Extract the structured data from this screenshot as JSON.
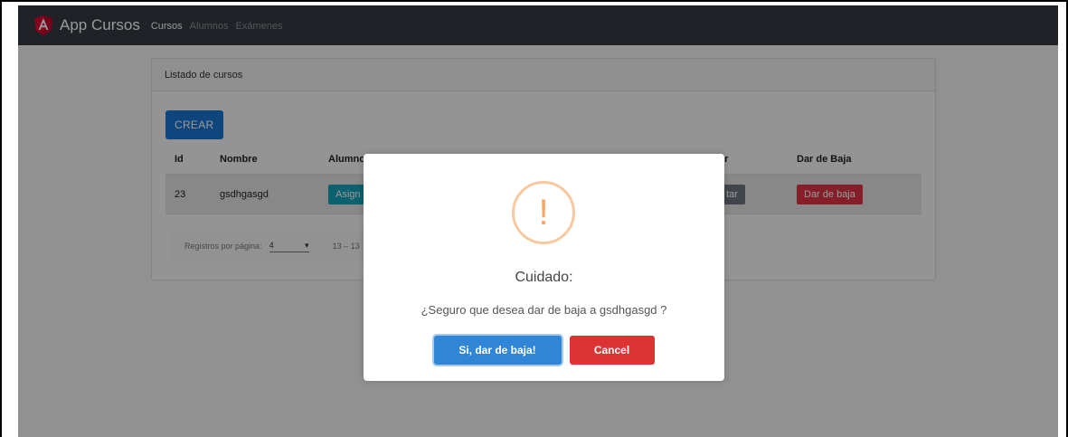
{
  "navbar": {
    "brand": "App Cursos",
    "logo_icon": "angular-logo-icon",
    "links": [
      {
        "label": "Cursos",
        "active": true
      },
      {
        "label": "Alumnos",
        "active": false
      },
      {
        "label": "Exámenes",
        "active": false
      }
    ]
  },
  "card": {
    "header": "Listado de cursos",
    "create_button": "CREAR",
    "table": {
      "headers": [
        "Id",
        "Nombre",
        "Alumno",
        "ar",
        "Dar de Baja"
      ],
      "rows": [
        {
          "id": "23",
          "nombre": "gsdhgasgd",
          "asignar_label": "Asign",
          "editar_label": "tar",
          "baja_label": "Dar de baja"
        }
      ]
    },
    "paginator": {
      "label": "Registros por página:",
      "page_size": "4",
      "range": "13 – 13"
    }
  },
  "modal": {
    "icon": "warning-icon",
    "icon_glyph": "!",
    "title": "Cuidado:",
    "text": "¿Seguro que desea dar de baja a gsdhgasgd ?",
    "confirm_label": "Si, dar de baja!",
    "cancel_label": "Cancel"
  },
  "colors": {
    "navbar": "#343a40",
    "primary": "#1a73d0",
    "confirm": "#3085d6",
    "cancel": "#dd3333",
    "warning": "#f8bb86"
  }
}
